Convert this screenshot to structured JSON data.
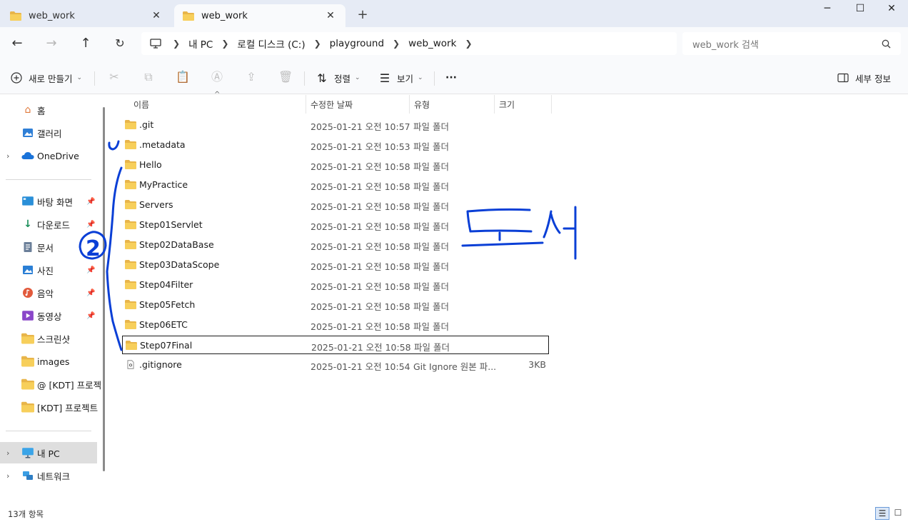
{
  "tabs": [
    {
      "label": "web_work",
      "close": "✕"
    },
    {
      "label": "web_work",
      "close": "✕"
    }
  ],
  "new_tab": "+",
  "window_controls": {
    "minimize": "─",
    "maximize": "☐",
    "close": "✕"
  },
  "breadcrumb": [
    "내 PC",
    "로컬 디스크 (C:)",
    "playground",
    "web_work"
  ],
  "search": {
    "placeholder": "web_work 검색"
  },
  "toolbar": {
    "new_label": "새로 만들기",
    "sort_label": "정렬",
    "view_label": "보기",
    "more_label": "···",
    "details_label": "세부 정보"
  },
  "sidebar": {
    "items": [
      {
        "label": "홈",
        "icon": "home-icon"
      },
      {
        "label": "갤러리",
        "icon": "gallery-icon"
      },
      {
        "label": "OneDrive",
        "icon": "cloud-icon"
      },
      {
        "label": "바탕 화면",
        "icon": "desktop-icon"
      },
      {
        "label": "다운로드",
        "icon": "download-icon"
      },
      {
        "label": "문서",
        "icon": "document-icon"
      },
      {
        "label": "사진",
        "icon": "pictures-icon"
      },
      {
        "label": "음악",
        "icon": "music-icon"
      },
      {
        "label": "동영상",
        "icon": "video-icon"
      },
      {
        "label": "스크린샷",
        "icon": "folder-icon"
      },
      {
        "label": "images",
        "icon": "folder-icon"
      },
      {
        "label": "@ [KDT] 프로젝",
        "icon": "folder-icon"
      },
      {
        "label": "[KDT] 프로젝트",
        "icon": "folder-icon"
      },
      {
        "label": "내 PC",
        "icon": "pc-icon"
      },
      {
        "label": "네트워크",
        "icon": "network-icon"
      }
    ]
  },
  "columns": {
    "name": "이름",
    "modified": "수정한 날짜",
    "type": "유형",
    "size": "크기"
  },
  "files": [
    {
      "name": ".git",
      "modified": "2025-01-21 오전 10:57",
      "type": "파일 폴더",
      "size": ""
    },
    {
      "name": ".metadata",
      "modified": "2025-01-21 오전 10:53",
      "type": "파일 폴더",
      "size": ""
    },
    {
      "name": "Hello",
      "modified": "2025-01-21 오전 10:58",
      "type": "파일 폴더",
      "size": ""
    },
    {
      "name": "MyPractice",
      "modified": "2025-01-21 오전 10:58",
      "type": "파일 폴더",
      "size": ""
    },
    {
      "name": "Servers",
      "modified": "2025-01-21 오전 10:58",
      "type": "파일 폴더",
      "size": ""
    },
    {
      "name": "Step01Servlet",
      "modified": "2025-01-21 오전 10:58",
      "type": "파일 폴더",
      "size": ""
    },
    {
      "name": "Step02DataBase",
      "modified": "2025-01-21 오전 10:58",
      "type": "파일 폴더",
      "size": ""
    },
    {
      "name": "Step03DataScope",
      "modified": "2025-01-21 오전 10:58",
      "type": "파일 폴더",
      "size": ""
    },
    {
      "name": "Step04Filter",
      "modified": "2025-01-21 오전 10:58",
      "type": "파일 폴더",
      "size": ""
    },
    {
      "name": "Step05Fetch",
      "modified": "2025-01-21 오전 10:58",
      "type": "파일 폴더",
      "size": ""
    },
    {
      "name": "Step06ETC",
      "modified": "2025-01-21 오전 10:58",
      "type": "파일 폴더",
      "size": ""
    },
    {
      "name": "Step07Final",
      "modified": "2025-01-21 오전 10:58",
      "type": "파일 폴더",
      "size": ""
    },
    {
      "name": ".gitignore",
      "modified": "2025-01-21 오전 10:54",
      "type": "Git Ignore 원본 파...",
      "size": "3KB"
    }
  ],
  "status": {
    "count": "13개 항목"
  },
  "annotations": {
    "number": "2",
    "handwriting": "복사"
  },
  "colors": {
    "ink": "#0a3fd6",
    "folder": "#f7cf5b",
    "selected_nav": "#dedede"
  }
}
